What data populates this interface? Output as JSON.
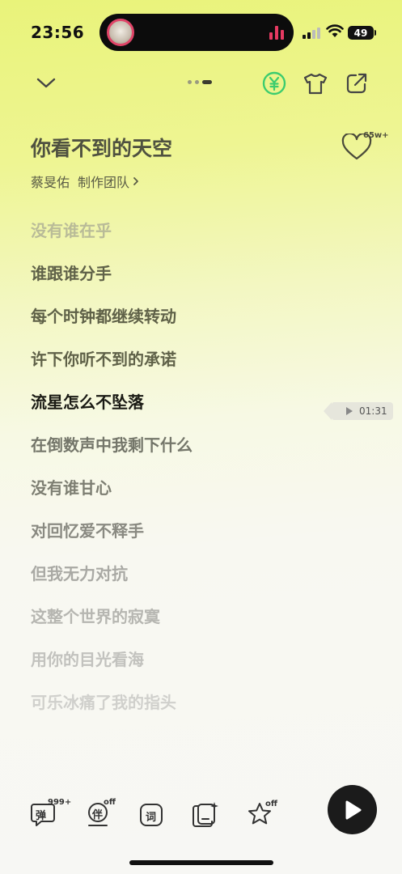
{
  "status_bar": {
    "time": "23:56",
    "battery_level": 49,
    "battery_text": "49",
    "island_icon": "now-playing-bars-icon"
  },
  "song": {
    "title": "你看不到的天空",
    "artist": "蔡旻佑",
    "credits_link": "制作团队",
    "like_count": "65w+"
  },
  "lyrics": [
    {
      "text": "没有谁在乎",
      "state": "past"
    },
    {
      "text": "谁跟谁分手",
      "state": "past"
    },
    {
      "text": "每个时钟都继续转动",
      "state": "past"
    },
    {
      "text": "许下你听不到的承诺",
      "state": "past"
    },
    {
      "text": "流星怎么不坠落",
      "state": "current"
    },
    {
      "text": "在倒数声中我剩下什么",
      "state": "next"
    },
    {
      "text": "没有谁甘心",
      "state": "upcoming"
    },
    {
      "text": "对回忆爱不释手",
      "state": "upcoming"
    },
    {
      "text": "但我无力对抗",
      "state": "upcoming"
    },
    {
      "text": "这整个世界的寂寞",
      "state": "upcoming"
    },
    {
      "text": "用你的目光看海",
      "state": "upcoming"
    },
    {
      "text": "可乐冰痛了我的指头",
      "state": "upcoming"
    }
  ],
  "seek_badge": {
    "time": "01:31"
  },
  "toolbar": {
    "danmaku_label": "弹",
    "danmaku_count": "999+",
    "accompany_label": "伴",
    "accompany_state": "off",
    "lyrics_label": "词",
    "effects_state": "off"
  },
  "colors": {
    "accent_green": "#3dcc6e",
    "current_lyric": "#1a1a14",
    "island_accent": "#e63a62"
  }
}
